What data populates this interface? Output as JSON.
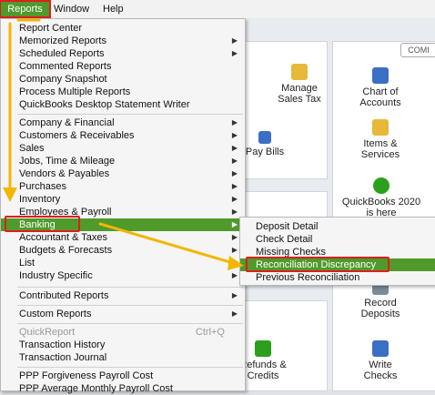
{
  "menubar": {
    "items": [
      {
        "label": "Reports"
      },
      {
        "label": "Window"
      },
      {
        "label": "Help"
      }
    ]
  },
  "home": {
    "company_button": "COMI",
    "tiles": [
      {
        "label": "Manage Sales Tax",
        "icon": "sales-tax-icon"
      },
      {
        "label": "Chart of Accounts",
        "icon": "chart-of-accounts-icon"
      },
      {
        "label": "Pay Bills",
        "icon": "pay-bills-icon"
      },
      {
        "label": "Items & Services",
        "icon": "items-services-icon"
      },
      {
        "label": "QuickBooks 2020 is here",
        "icon": "quickbooks-icon"
      },
      {
        "label": "Record Deposits",
        "icon": "record-deposits-icon"
      },
      {
        "label": "Refunds & Credits",
        "icon": "refunds-credits-icon"
      },
      {
        "label": "Write Checks",
        "icon": "write-checks-icon"
      }
    ]
  },
  "reports_menu": {
    "items": [
      {
        "label": "Report Center"
      },
      {
        "label": "Memorized Reports"
      },
      {
        "label": "Scheduled Reports"
      },
      {
        "label": "Commented Reports"
      },
      {
        "label": "Company Snapshot"
      },
      {
        "label": "Process Multiple Reports"
      },
      {
        "label": "QuickBooks Desktop Statement Writer"
      },
      {
        "label": "Company & Financial"
      },
      {
        "label": "Customers & Receivables"
      },
      {
        "label": "Sales"
      },
      {
        "label": "Jobs, Time & Mileage"
      },
      {
        "label": "Vendors & Payables"
      },
      {
        "label": "Purchases"
      },
      {
        "label": "Inventory"
      },
      {
        "label": "Employees & Payroll"
      },
      {
        "label": "Banking"
      },
      {
        "label": "Accountant & Taxes"
      },
      {
        "label": "Budgets & Forecasts"
      },
      {
        "label": "List"
      },
      {
        "label": "Industry Specific"
      },
      {
        "label": "Contributed Reports"
      },
      {
        "label": "Custom Reports"
      },
      {
        "label": "QuickReport",
        "shortcut": "Ctrl+Q"
      },
      {
        "label": "Transaction History"
      },
      {
        "label": "Transaction Journal"
      },
      {
        "label": "PPP Forgiveness Payroll Cost"
      },
      {
        "label": "PPP Average Monthly Payroll Cost"
      }
    ]
  },
  "banking_submenu": {
    "items": [
      {
        "label": "Deposit Detail"
      },
      {
        "label": "Check Detail"
      },
      {
        "label": "Missing Checks"
      },
      {
        "label": "Reconciliation Discrepancy"
      },
      {
        "label": "Previous Reconciliation"
      }
    ]
  },
  "colors": {
    "highlight_green": "#4f9a2b",
    "annotation_red": "#e01d1d",
    "annotation_arrow": "#f2b705"
  }
}
